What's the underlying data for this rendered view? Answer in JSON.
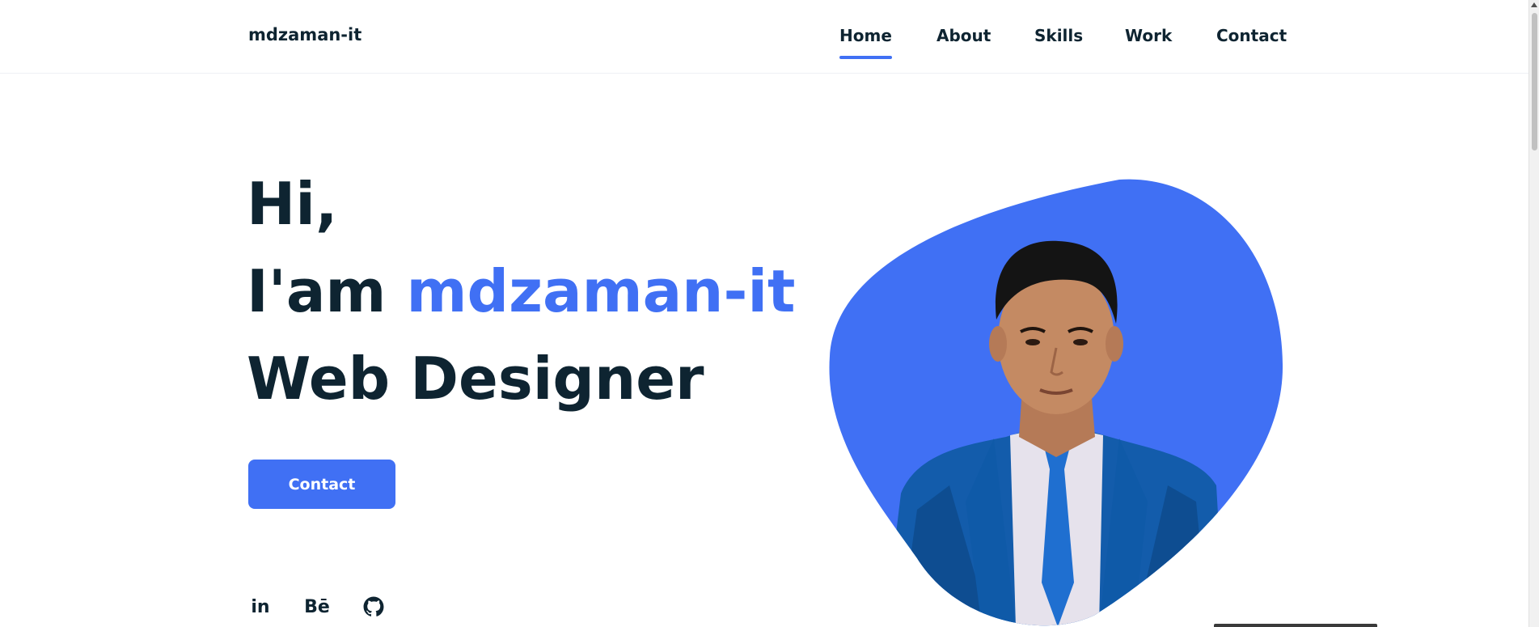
{
  "header": {
    "logo": "mdzaman-it",
    "nav": [
      {
        "label": "Home",
        "active": true
      },
      {
        "label": "About",
        "active": false
      },
      {
        "label": "Skills",
        "active": false
      },
      {
        "label": "Work",
        "active": false
      },
      {
        "label": "Contact",
        "active": false
      }
    ]
  },
  "hero": {
    "greeting": "Hi,",
    "intro_prefix": "I'am ",
    "name": "mdzaman-it",
    "role": "Web Designer",
    "button_label": "Contact"
  },
  "social": [
    {
      "icon": "linkedin-icon",
      "text": "in"
    },
    {
      "icon": "behance-icon",
      "text": "Bē"
    },
    {
      "icon": "github-icon",
      "text": ""
    }
  ],
  "colors": {
    "accent": "#4070f4",
    "text": "#0e2431",
    "background": "#ffffff"
  }
}
